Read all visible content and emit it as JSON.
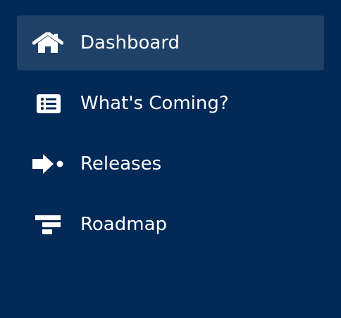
{
  "sidebar": {
    "items": [
      {
        "label": "Dashboard",
        "icon": "home-icon",
        "active": true
      },
      {
        "label": "What's Coming?",
        "icon": "list-icon",
        "active": false
      },
      {
        "label": "Releases",
        "icon": "release-arrow-icon",
        "active": false
      },
      {
        "label": "Roadmap",
        "icon": "roadmap-icon",
        "active": false
      }
    ]
  },
  "colors": {
    "background": "#032956",
    "active_background": "#1f4168",
    "text": "#ffffff"
  }
}
